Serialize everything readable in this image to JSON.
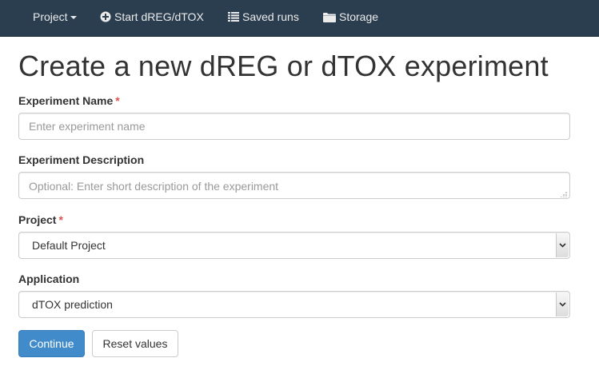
{
  "navbar": {
    "items": [
      {
        "label": "Project",
        "icon": "",
        "has_caret": true
      },
      {
        "label": "Start dREG/dTOX",
        "icon": "plus-circle-icon"
      },
      {
        "label": "Saved runs",
        "icon": "list-icon"
      },
      {
        "label": "Storage",
        "icon": "folder-icon"
      }
    ],
    "background": "#2b3e50"
  },
  "page": {
    "title": "Create a new dREG or dTOX experiment"
  },
  "form": {
    "experiment_name": {
      "label": "Experiment Name",
      "required_marker": "*",
      "value": "",
      "placeholder": "Enter experiment name"
    },
    "experiment_description": {
      "label": "Experiment Description",
      "value": "",
      "placeholder": "Optional: Enter short description of the experiment"
    },
    "project": {
      "label": "Project",
      "required_marker": "*",
      "selected": "Default Project"
    },
    "application": {
      "label": "Application",
      "selected": "dTOX prediction"
    }
  },
  "buttons": {
    "continue_label": "Continue",
    "reset_label": "Reset values"
  },
  "colors": {
    "primary": "#428bca",
    "required": "#d9534f"
  }
}
